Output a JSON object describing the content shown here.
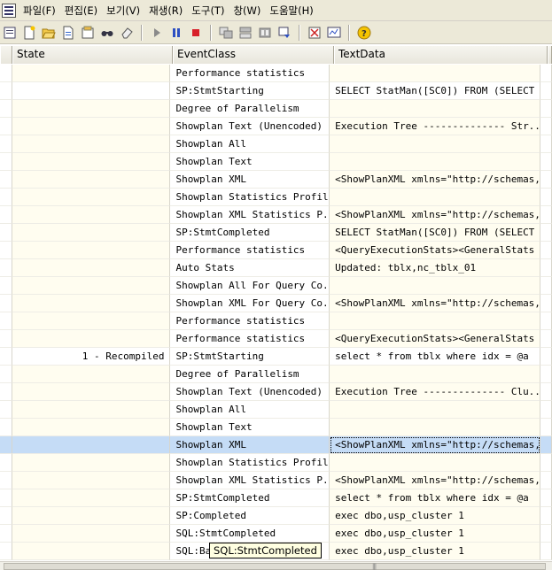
{
  "menu": {
    "items": [
      "파일(F)",
      "편집(E)",
      "보기(V)",
      "재생(R)",
      "도구(T)",
      "창(W)",
      "도움말(H)"
    ]
  },
  "toolbar": {
    "icons": [
      "new-trace-icon",
      "new-file-icon",
      "open-icon",
      "save-icon",
      "properties-icon",
      "find-icon",
      "clear-icon",
      "run-icon",
      "pause-icon",
      "stop-icon",
      "window-icon",
      "window2-icon",
      "tile-icon",
      "scroll-icon",
      "props-icon",
      "monitor-icon",
      "help-icon"
    ]
  },
  "grid": {
    "columns": [
      "",
      "State",
      "EventClass",
      "TextData",
      ""
    ],
    "rows": [
      {
        "state": "",
        "event": "Performance statistics",
        "text": "",
        "yellow": true
      },
      {
        "state": "",
        "event": "SP:StmtStarting",
        "text": "SELECT StatMan([SC0]) FROM (SELECT ...",
        "yellow": false
      },
      {
        "state": "",
        "event": "Degree of Parallelism",
        "text": "",
        "yellow": true
      },
      {
        "state": "",
        "event": "Showplan Text (Unencoded)",
        "text": "Execution Tree  --------------  Str...",
        "yellow": true
      },
      {
        "state": "",
        "event": "Showplan All",
        "text": "",
        "yellow": true
      },
      {
        "state": "",
        "event": "Showplan Text",
        "text": "",
        "yellow": true
      },
      {
        "state": "",
        "event": "Showplan XML",
        "text": "<ShowPlanXML xmlns=\"http://schemas,...",
        "yellow": true
      },
      {
        "state": "",
        "event": "Showplan Statistics Profile",
        "text": "",
        "yellow": true
      },
      {
        "state": "",
        "event": "Showplan XML Statistics P...",
        "text": "<ShowPlanXML xmlns=\"http://schemas,...",
        "yellow": true
      },
      {
        "state": "",
        "event": "SP:StmtCompleted",
        "text": "SELECT StatMan([SC0]) FROM (SELECT ...",
        "yellow": true
      },
      {
        "state": "",
        "event": "Performance statistics",
        "text": "<QueryExecutionStats><GeneralStats ...",
        "yellow": true
      },
      {
        "state": "",
        "event": "Auto Stats",
        "text": "Updated: tblx,nc_tblx_01",
        "yellow": true
      },
      {
        "state": "",
        "event": "Showplan All For Query Co...",
        "text": "",
        "yellow": true
      },
      {
        "state": "",
        "event": "Showplan XML For Query Co...",
        "text": "<ShowPlanXML xmlns=\"http://schemas,...",
        "yellow": true
      },
      {
        "state": "",
        "event": "Performance statistics",
        "text": "",
        "yellow": true
      },
      {
        "state": "",
        "event": "Performance statistics",
        "text": "<QueryExecutionStats><GeneralStats ...",
        "yellow": true
      },
      {
        "state": "1 - Recompiled",
        "event": "SP:StmtStarting",
        "text": "select * from tblx where idx = @a",
        "yellow": false
      },
      {
        "state": "",
        "event": "Degree of Parallelism",
        "text": "",
        "yellow": true
      },
      {
        "state": "",
        "event": "Showplan Text (Unencoded)",
        "text": "Execution Tree  --------------  Clu...",
        "yellow": true
      },
      {
        "state": "",
        "event": "Showplan All",
        "text": "",
        "yellow": true
      },
      {
        "state": "",
        "event": "Showplan Text",
        "text": "",
        "yellow": true
      },
      {
        "state": "",
        "event": "Showplan XML",
        "text": "<ShowPlanXML xmlns=\"http://schemas,...",
        "yellow": true,
        "selected": true
      },
      {
        "state": "",
        "event": "Showplan Statistics Profile",
        "text": "",
        "yellow": true
      },
      {
        "state": "",
        "event": "Showplan XML Statistics P...",
        "text": "<ShowPlanXML xmlns=\"http://schemas,...",
        "yellow": true
      },
      {
        "state": "",
        "event": "SP:StmtCompleted",
        "text": "select * from tblx where idx = @a",
        "yellow": true
      },
      {
        "state": "",
        "event": "SP:Completed",
        "text": "exec dbo,usp_cluster 1",
        "yellow": true
      },
      {
        "state": "",
        "event": "SQL:StmtCompleted",
        "text": "exec dbo,usp_cluster 1",
        "yellow": true
      },
      {
        "state": "",
        "event": "SQL:Ba",
        "text": "exec dbo,usp_cluster 1",
        "yellow": true
      }
    ]
  },
  "tooltip": {
    "text": "SQL:StmtCompleted"
  },
  "colors": {
    "row_yellow": "#fffdf0",
    "selected": "#c5dcf6",
    "tooltip_bg": "#ffffe1"
  }
}
